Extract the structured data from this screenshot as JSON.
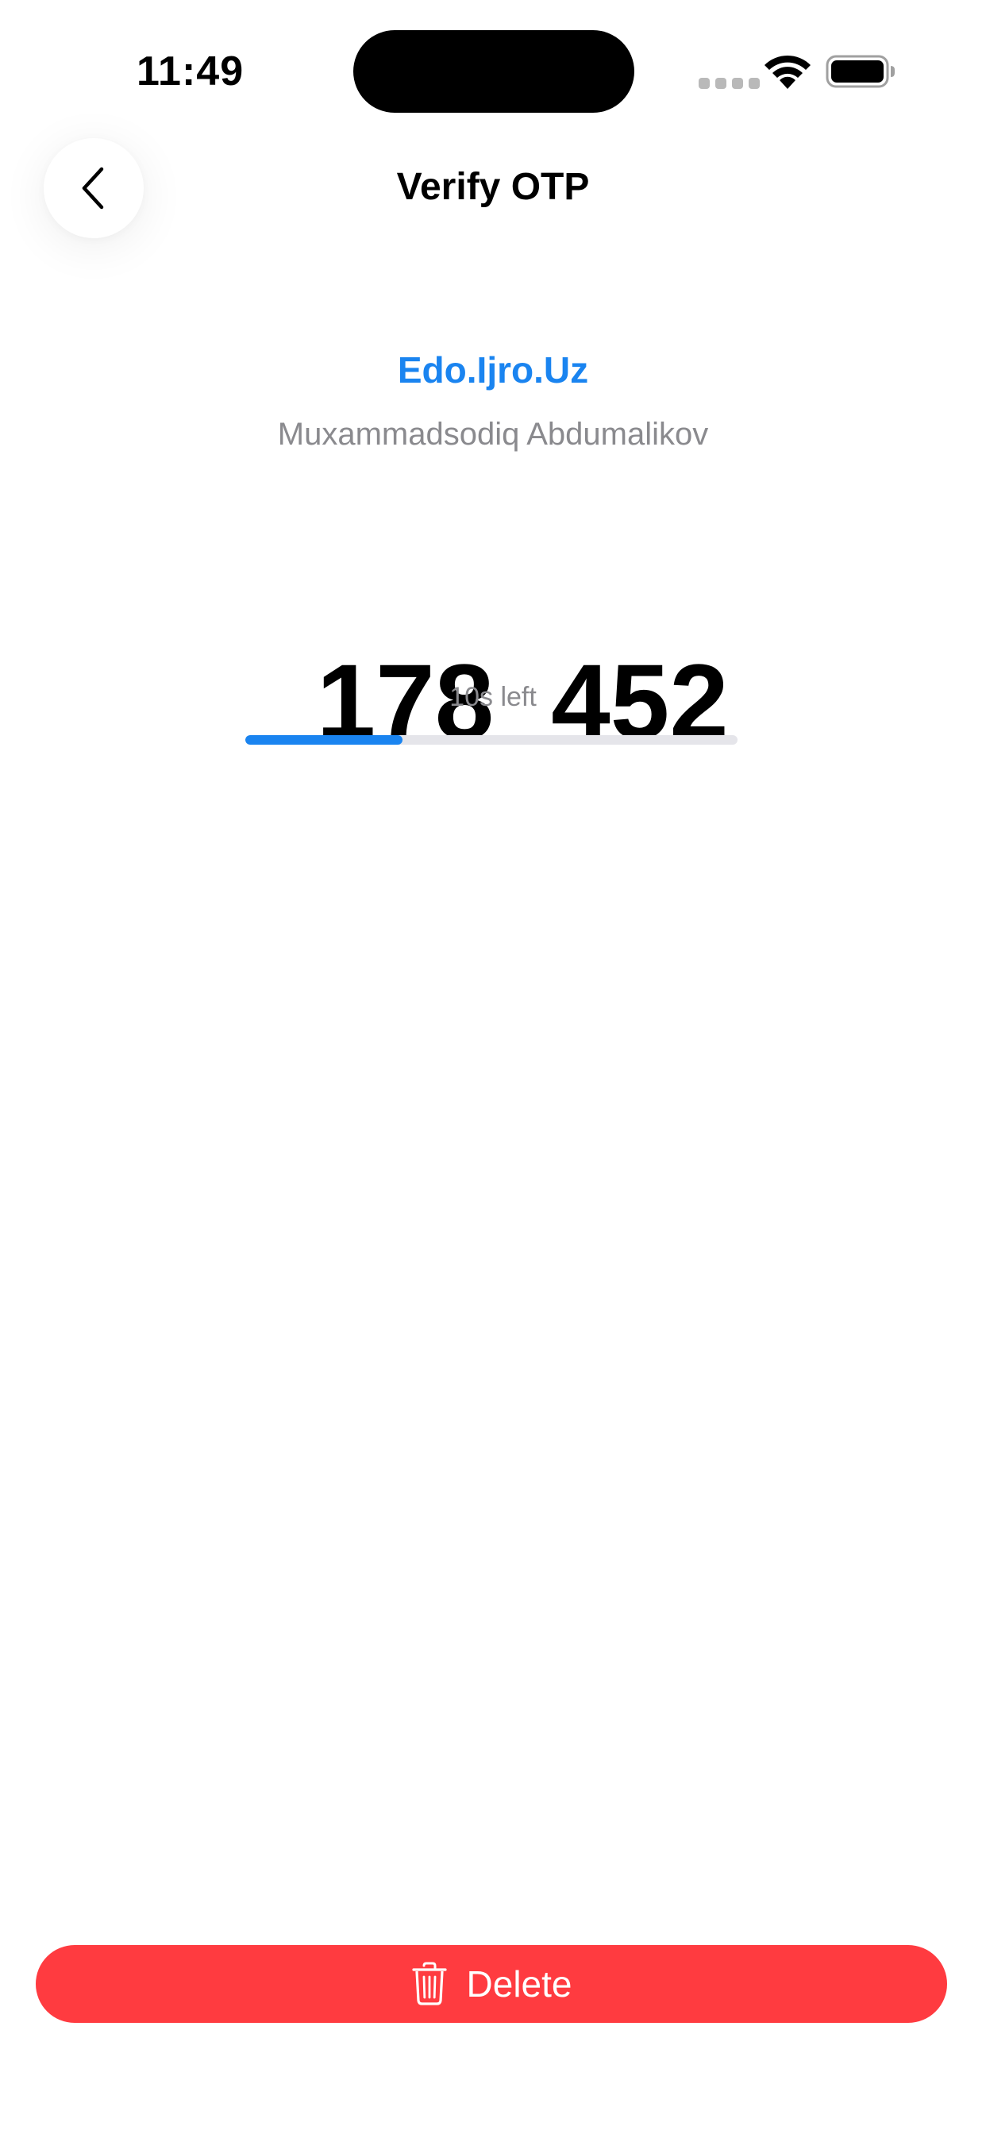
{
  "status_bar": {
    "time": "11:49"
  },
  "header": {
    "title": "Verify OTP",
    "back_icon": "chevron-left-icon"
  },
  "account": {
    "issuer": "Edo.Ijro.Uz",
    "name": "Muxammadsodiq Abdumalikov"
  },
  "otp": {
    "code_part1": "178",
    "code_part2": "452",
    "time_left_label": "10s left",
    "progress_fraction": 0.32
  },
  "actions": {
    "delete_label": "Delete",
    "delete_icon": "trash-icon"
  },
  "colors": {
    "accent": "#1a84f0",
    "danger": "#ff3b40",
    "secondary_text": "#8a8a8e"
  }
}
